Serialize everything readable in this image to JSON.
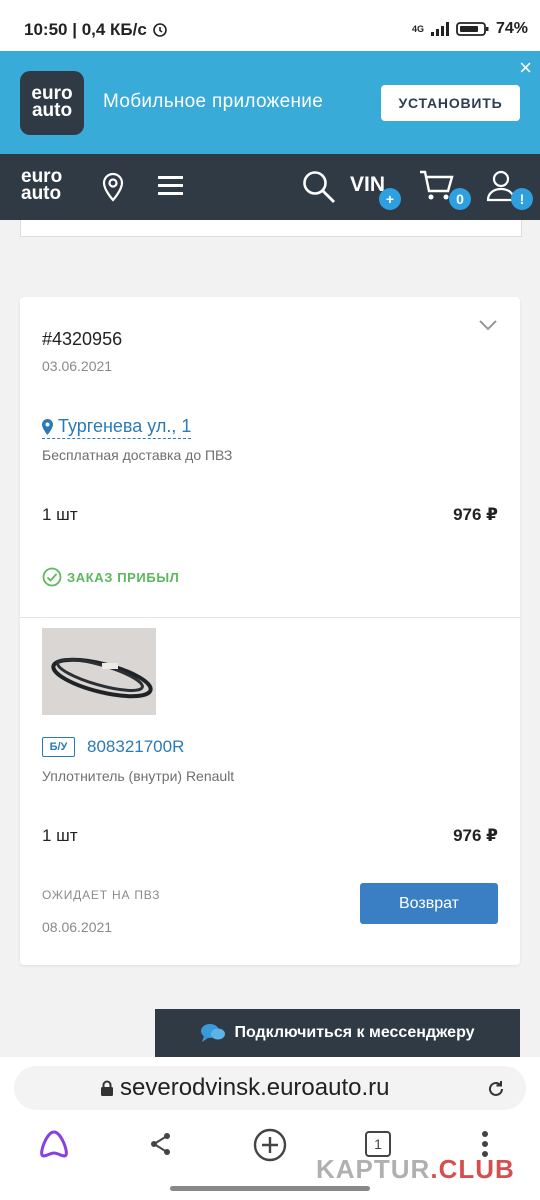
{
  "status_bar": {
    "time": "10:50",
    "speed": "0,4 КБ/с",
    "network": "4G",
    "battery": "74%"
  },
  "app_banner": {
    "logo_line1": "euro",
    "logo_line2": "auto",
    "title": "Мобильное приложение",
    "install_label": "УСТАНОВИТЬ",
    "close_icon": "close-icon"
  },
  "nav": {
    "logo_line1": "euro",
    "logo_line2": "auto",
    "vin_label": "VIN",
    "vin_badge": "+",
    "cart_count": "0",
    "profile_badge": "!"
  },
  "order": {
    "number": "#4320956",
    "date": "03.06.2021",
    "address": "Тургенева ул., 1",
    "delivery": "Бесплатная доставка до ПВЗ",
    "quantity": "1 шт",
    "price": "976 ₽",
    "status": "ЗАКАЗ ПРИБЫЛ",
    "item": {
      "condition": "Б/У",
      "part_number": "808321700R",
      "name": "Уплотнитель (внутри) Renault",
      "quantity": "1 шт",
      "price": "976 ₽",
      "pickup_status": "ОЖИДАЕТ НА ПВЗ",
      "pickup_date": "08.06.2021",
      "return_label": "Возврат"
    }
  },
  "messenger": {
    "label": "Подключиться к мессенджеру"
  },
  "browser": {
    "url": "severodvinsk.euroauto.ru",
    "tab_count": "1"
  },
  "watermark": {
    "part1": "KAPTUR",
    "part2": ".CLUB"
  },
  "colors": {
    "banner": "#39abd8",
    "nav": "#2f3a44",
    "link": "#2a7ab8",
    "success": "#5cb85c",
    "primary_button": "#3a7fc4"
  }
}
